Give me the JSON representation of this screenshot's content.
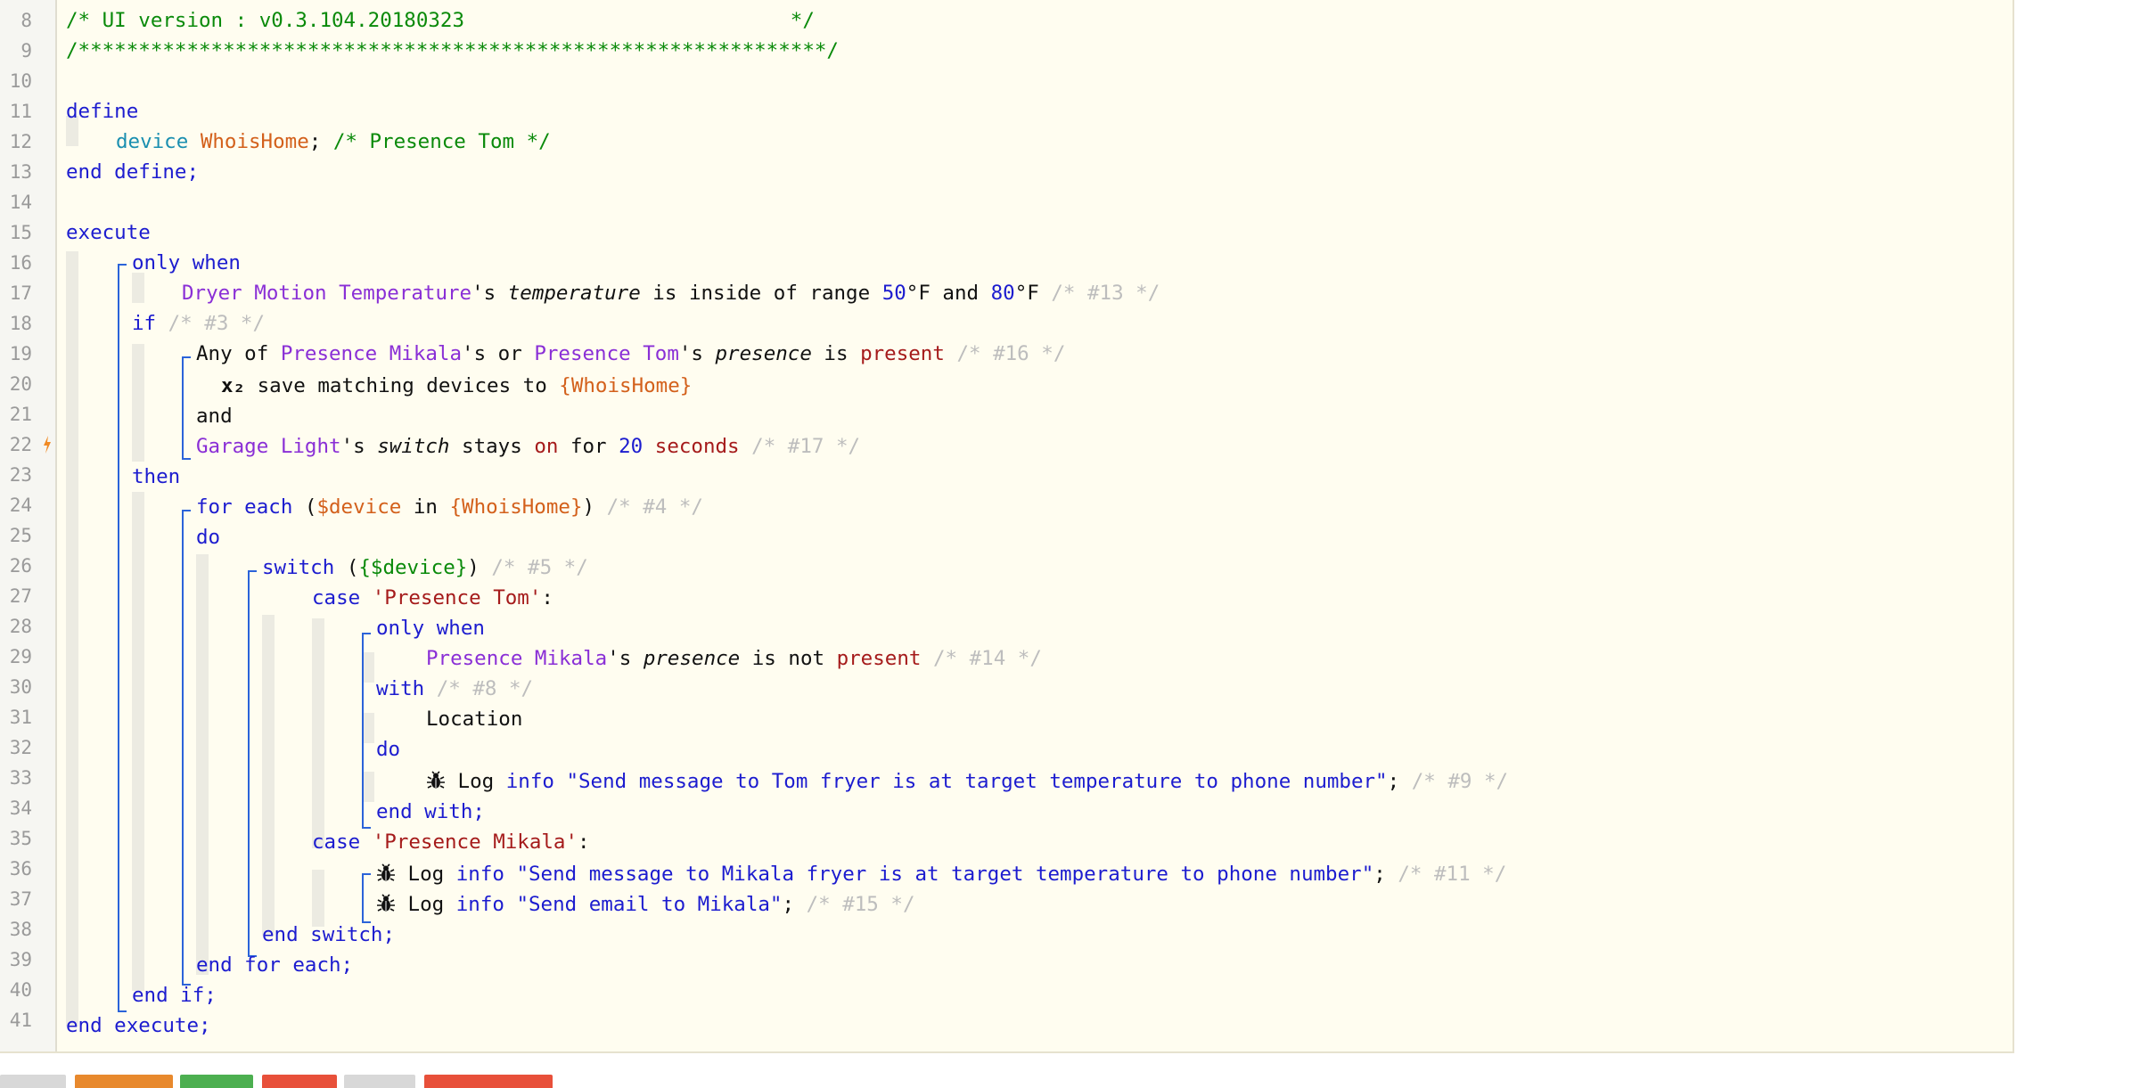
{
  "editor": {
    "line_numbers": [
      "8",
      "9",
      "10",
      "11",
      "12",
      "13",
      "14",
      "15",
      "16",
      "17",
      "18",
      "19",
      "20",
      "21",
      "22",
      "23",
      "24",
      "25",
      "26",
      "27",
      "28",
      "29",
      "30",
      "31",
      "32",
      "33",
      "34",
      "35",
      "36",
      "37",
      "38",
      "39",
      "40",
      "41"
    ],
    "header": {
      "version_line": "/* UI version : v0.3.104.20180323                           */",
      "stars_line": "/**************************************************************/"
    },
    "define": {
      "open": "define",
      "device_kw": "device",
      "device_var": "WhoisHome",
      "semicolon": ";",
      "device_comment": "/* Presence Tom */",
      "close": "end define;"
    },
    "execute": {
      "open": "execute",
      "only_when_kw": "only when",
      "l17_dev": "Dryer Motion Temperature",
      "l17_poss": "'s ",
      "l17_attr": "temperature",
      "l17_mid": " is inside of range ",
      "l17_n1": "50",
      "l17_u1": "°F and ",
      "l17_n2": "80",
      "l17_u2": "°F ",
      "l17_cmt": "/* #13 */",
      "if_kw": "if",
      "if_cmt": " /* #3 */",
      "l19_a": "Any of ",
      "l19_dev1": "Presence Mikala",
      "l19_b": "'s or ",
      "l19_dev2": "Presence Tom",
      "l19_c": "'s ",
      "l19_attr": "presence",
      "l19_d": " is ",
      "l19_val": "present",
      "l19_cmt": " /* #16 */",
      "l20_x": "x₂",
      "l20_text": " save matching devices to ",
      "l20_var": "{WhoisHome}",
      "and": "and",
      "l22_dev": "Garage Light",
      "l22_a": "'s ",
      "l22_attr": "switch",
      "l22_b": " stays ",
      "l22_val": "on",
      "l22_c": " for ",
      "l22_num": "20",
      "l22_unit": " seconds",
      "l22_cmt": " /* #17 */",
      "then_kw": "then",
      "l24_kw": "for each",
      "l24_a": " (",
      "l24_var": "$device",
      "l24_b": " in ",
      "l24_var2": "{WhoisHome}",
      "l24_c": ")",
      "l24_cmt": " /* #4 */",
      "do_kw": "do",
      "l26_kw": "switch",
      "l26_a": " (",
      "l26_var": "{$device}",
      "l26_b": ")",
      "l26_cmt": " /* #5 */",
      "l27_kw": "case",
      "l27_str": " 'Presence Tom'",
      "l27_colon": ":",
      "l28_kw": "only when",
      "l29_dev": "Presence Mikala",
      "l29_a": "'s ",
      "l29_attr": "presence",
      "l29_b": " is not ",
      "l29_val": "present",
      "l29_cmt": " /* #14 */",
      "l30_kw": "with",
      "l30_cmt": " /* #8 */",
      "l31_text": "Location",
      "l32_kw": "do",
      "l33_a": " Log ",
      "l33_kw": "info",
      "l33_str": " \"Send message to Tom fryer is at target temperature to phone number\"",
      "l33_semi": ";",
      "l33_cmt": " /* #9 */",
      "l34_kw": "end with;",
      "l35_kw": "case",
      "l35_str": " 'Presence Mikala'",
      "l35_colon": ":",
      "l36_a": " Log ",
      "l36_kw": "info",
      "l36_str": " \"Send message to Mikala fryer is at target temperature to phone number\"",
      "l36_semi": ";",
      "l36_cmt": " /* #11 */",
      "l37_a": " Log ",
      "l37_kw": "info",
      "l37_str": " \"Send email to Mikala\"",
      "l37_semi": ";",
      "l37_cmt": " /* #15 */",
      "l38_kw": "end switch;",
      "l39_kw": "end for each;",
      "l40_kw": "end if;",
      "close": "end execute;"
    }
  },
  "colors": {
    "editor_bg": "#fffdf0",
    "keyword": "#1c1ccf",
    "device": "#8a2fd6",
    "variable": "#d3601b",
    "string": "#a51b1b",
    "comment": "#bdbdbd",
    "header_comment": "#0a8a0a",
    "bracket": "#2b63d9",
    "gutter_mark": "#f08a24"
  },
  "bottom_bar": {
    "buttons": [
      {
        "color": "#d8d8d8"
      },
      {
        "color": "#e8892d"
      },
      {
        "color": "#4caf50"
      },
      {
        "color": "#e8503a"
      },
      {
        "color": "#d8d8d8"
      },
      {
        "color": "#e8503a"
      }
    ]
  }
}
